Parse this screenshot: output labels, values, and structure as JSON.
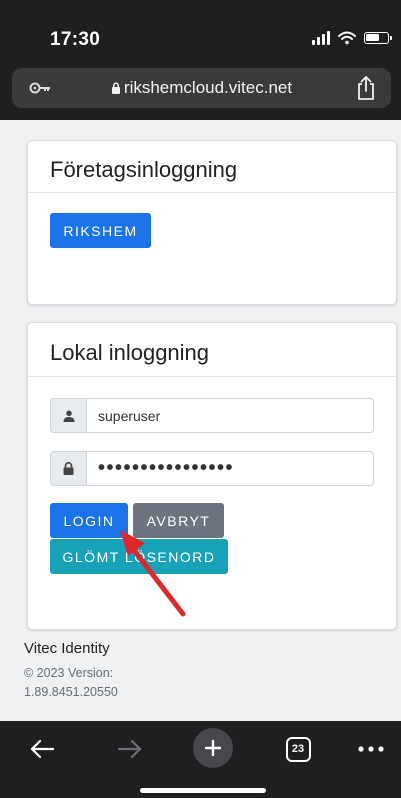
{
  "status_bar": {
    "time": "17:30"
  },
  "browser": {
    "url": "rikshemcloud.vitec.net",
    "tab_count": "23"
  },
  "company_login": {
    "heading": "Företagsinloggning",
    "provider_button": "RIKSHEM"
  },
  "local_login": {
    "heading": "Lokal inloggning",
    "username_value": "superuser",
    "password_value": "••••••••••••••••",
    "login_button": "LOGIN",
    "cancel_button": "AVBRYT",
    "forgot_button": "GLÖMT LÖSENORD"
  },
  "footer": {
    "title": "Vitec Identity",
    "copyright": "© 2023 Version:",
    "version": "1.89.8451.20550"
  },
  "colors": {
    "primary": "#1a73e8",
    "secondary": "#6c757d",
    "info": "#17a2b8",
    "annotation_arrow": "#e3262b"
  }
}
